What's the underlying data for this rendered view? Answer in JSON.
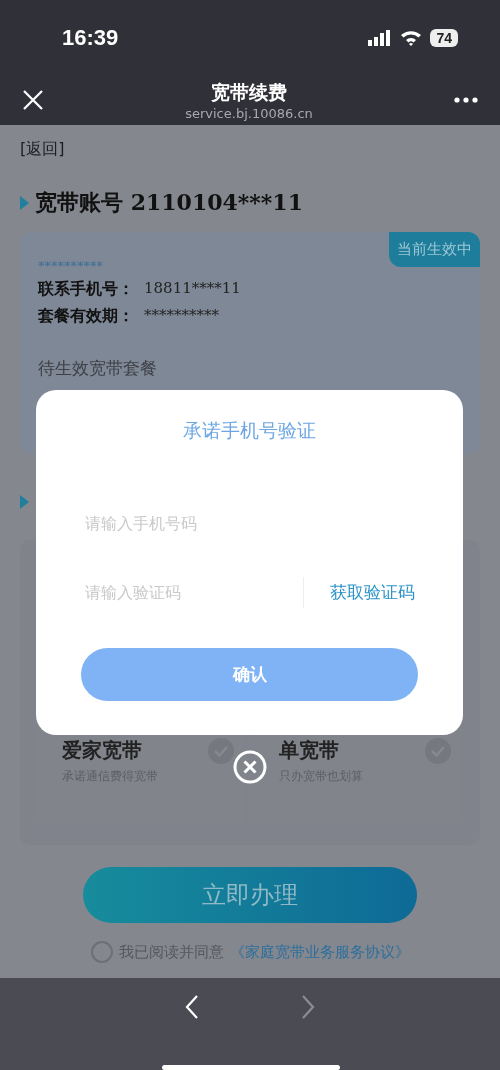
{
  "status_bar": {
    "time": "16:39",
    "battery": "74"
  },
  "nav": {
    "title": "宽带续费",
    "url": "service.bj.10086.cn"
  },
  "back_link": "[返回]",
  "account": {
    "label": "宽带账号",
    "number": "2110104***11"
  },
  "plan_card": {
    "badge": "当前生效中",
    "plan_name": "**********",
    "rows": [
      {
        "label": "联系手机号：",
        "value": "18811****11"
      },
      {
        "label": "套餐有效期：",
        "value": "**********"
      }
    ],
    "pending": "待生效宽带套餐"
  },
  "options": [
    {
      "title": "爱家宽带",
      "subtitle": "承诺通信费得宽带",
      "selected": false
    },
    {
      "title": "单宽带",
      "subtitle": "只办宽带也划算",
      "selected": false
    }
  ],
  "submit": "立即办理",
  "agreement": {
    "checked": false,
    "text": "我已阅读并同意",
    "link": "《家庭宽带业务服务协议》"
  },
  "modal": {
    "title": "承诺手机号验证",
    "phone_placeholder": "请输入手机号码",
    "code_placeholder": "请输入验证码",
    "get_code": "获取验证码",
    "confirm": "确认"
  }
}
